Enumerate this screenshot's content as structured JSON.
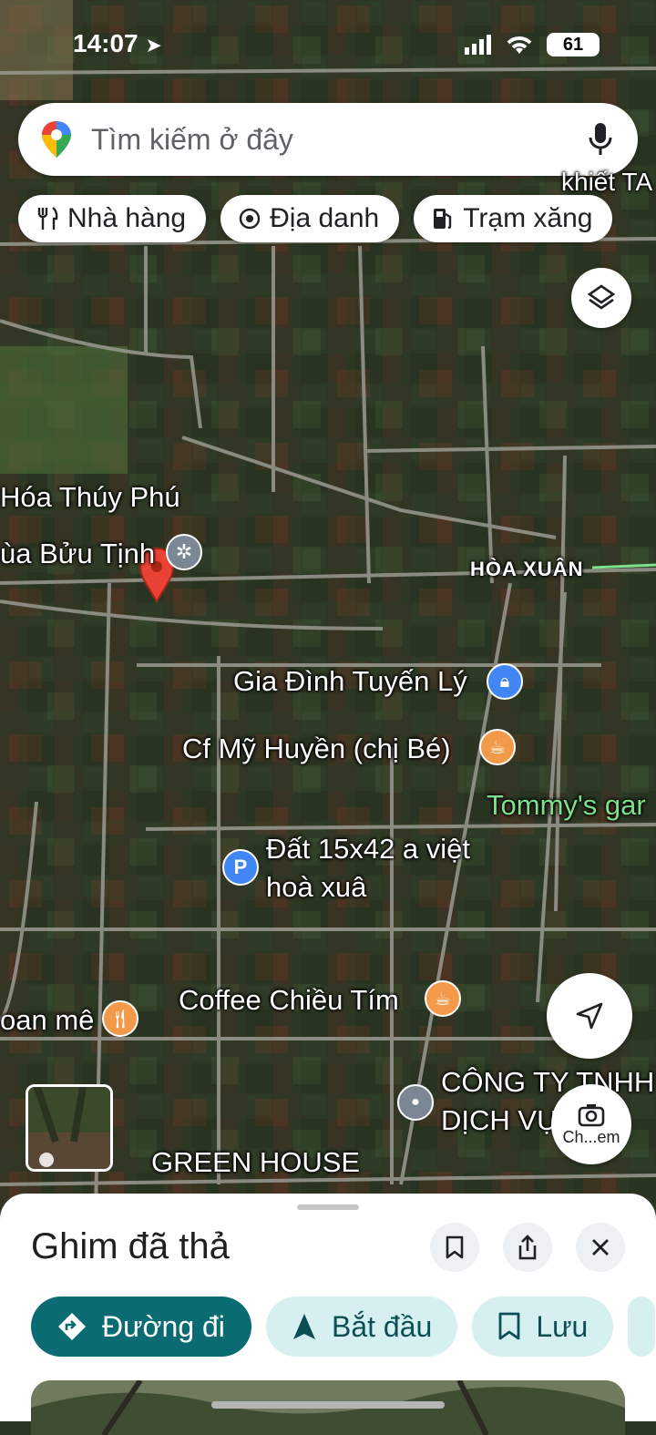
{
  "status": {
    "time": "14:07",
    "battery": "61"
  },
  "search": {
    "placeholder": "Tìm kiếm ở đây"
  },
  "chips": [
    {
      "label": "Nhà hàng",
      "icon": "restaurant-icon"
    },
    {
      "label": "Địa danh",
      "icon": "landmark-icon"
    },
    {
      "label": "Trạm xăng",
      "icon": "gas-station-icon"
    }
  ],
  "map": {
    "labels": {
      "partial_top_right": "khiết TA",
      "hoa_thuy_phu": "Hóa Thúy Phú",
      "bun_tinh": "ùa Bửu Tịnh",
      "hoa_xuan": "HÒA XUÂN",
      "gia_dinh": "Gia Đình Tuyến Lý",
      "cf_my_huyen": "Cf Mỹ Huyền (chị Bé)",
      "tommys": "Tommy's gar",
      "dat_line1": "Đất 15x42 a việt",
      "dat_line2": "hoà xuâ",
      "coffee_chieu_tim": "Coffee Chiều Tím",
      "ban_me": "oan mê",
      "cong_ty_line1": "CÔNG TY TNHH",
      "cong_ty_line2": "DỊCH VỤ THU",
      "green_house": "GREEN HOUSE"
    },
    "camera_label": "Ch...em"
  },
  "sheet": {
    "title": "Ghim đã thả",
    "actions": {
      "directions": "Đường đi",
      "start": "Bắt đầu",
      "save": "Lưu"
    }
  }
}
